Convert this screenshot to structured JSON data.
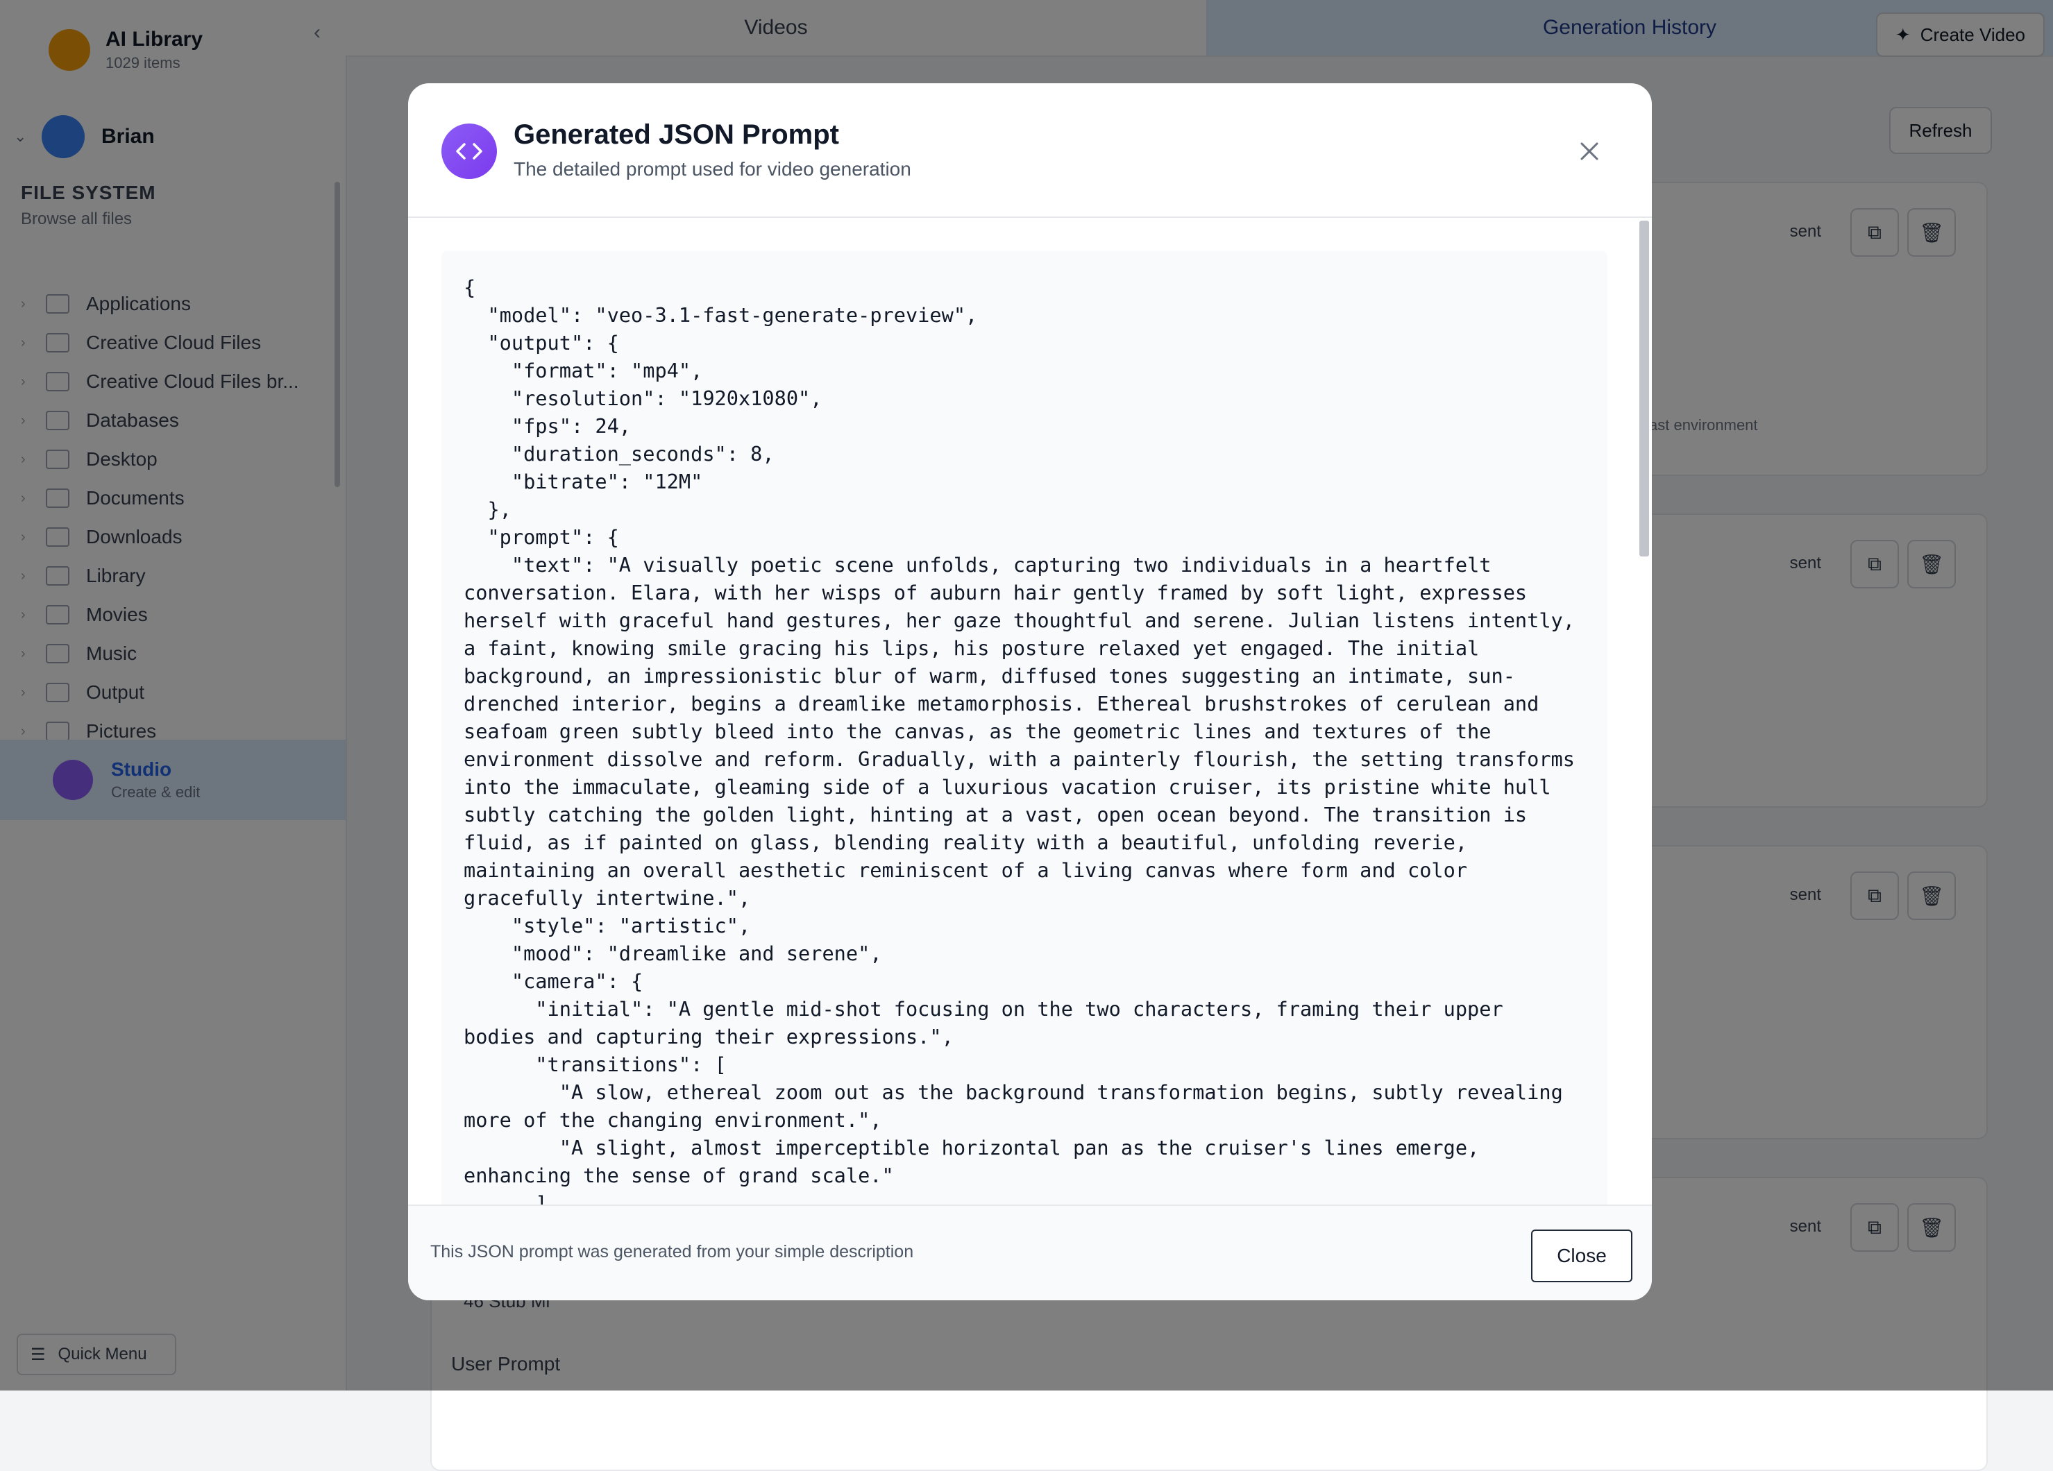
{
  "app": {
    "library_title": "AI Library",
    "library_subtitle": "1029 items",
    "user_name": "Brian",
    "filesystem_title": "FILE SYSTEM",
    "filesystem_subtitle": "Browse all files",
    "folders": [
      "Applications",
      "Creative Cloud Files",
      "Creative Cloud Files br...",
      "Databases",
      "Desktop",
      "Documents",
      "Downloads",
      "Library",
      "Movies",
      "Music",
      "Output",
      "Pictures"
    ],
    "studio_name": "Studio",
    "studio_subtitle": "Create & edit",
    "quick_menu": "Quick Menu",
    "tabs": {
      "videos": "Videos",
      "history": "Generation History"
    },
    "create_video": "Create Video",
    "refresh": "Refresh",
    "card_status": "sent",
    "faint_note": "ast environment",
    "bottom_label_a": "46 Stub Mi",
    "bottom_label_b": "User Prompt"
  },
  "modal": {
    "title": "Generated JSON Prompt",
    "subtitle": "The detailed prompt used for video generation",
    "code": "{\n  \"model\": \"veo-3.1-fast-generate-preview\",\n  \"output\": {\n    \"format\": \"mp4\",\n    \"resolution\": \"1920x1080\",\n    \"fps\": 24,\n    \"duration_seconds\": 8,\n    \"bitrate\": \"12M\"\n  },\n  \"prompt\": {\n    \"text\": \"A visually poetic scene unfolds, capturing two individuals in a heartfelt conversation. Elara, with her wisps of auburn hair gently framed by soft light, expresses herself with graceful hand gestures, her gaze thoughtful and serene. Julian listens intently, a faint, knowing smile gracing his lips, his posture relaxed yet engaged. The initial background, an impressionistic blur of warm, diffused tones suggesting an intimate, sun-drenched interior, begins a dreamlike metamorphosis. Ethereal brushstrokes of cerulean and seafoam green subtly bleed into the canvas, as the geometric lines and textures of the environment dissolve and reform. Gradually, with a painterly flourish, the setting transforms into the immaculate, gleaming side of a luxurious vacation cruiser, its pristine white hull subtly catching the golden light, hinting at a vast, open ocean beyond. The transition is fluid, as if painted on glass, blending reality with a beautiful, unfolding reverie, maintaining an overall aesthetic reminiscent of a living canvas where form and color gracefully intertwine.\",\n    \"style\": \"artistic\",\n    \"mood\": \"dreamlike and serene\",\n    \"camera\": {\n      \"initial\": \"A gentle mid-shot focusing on the two characters, framing their upper bodies and capturing their expressions.\",\n      \"transitions\": [\n        \"A slow, ethereal zoom out as the background transformation begins, subtly revealing more of the changing environment.\",\n        \"A slight, almost imperceptible horizontal pan as the cruiser's lines emerge, enhancing the sense of grand scale.\"\n      ]",
    "footer_note": "This JSON prompt was generated from your simple description",
    "close_label": "Close"
  },
  "icons": {
    "header_icon": "code-brackets-icon",
    "close": "close-icon"
  },
  "colors": {
    "accent": "#8b5cf6",
    "overlay": "rgba(0,0,0,0.5)"
  }
}
